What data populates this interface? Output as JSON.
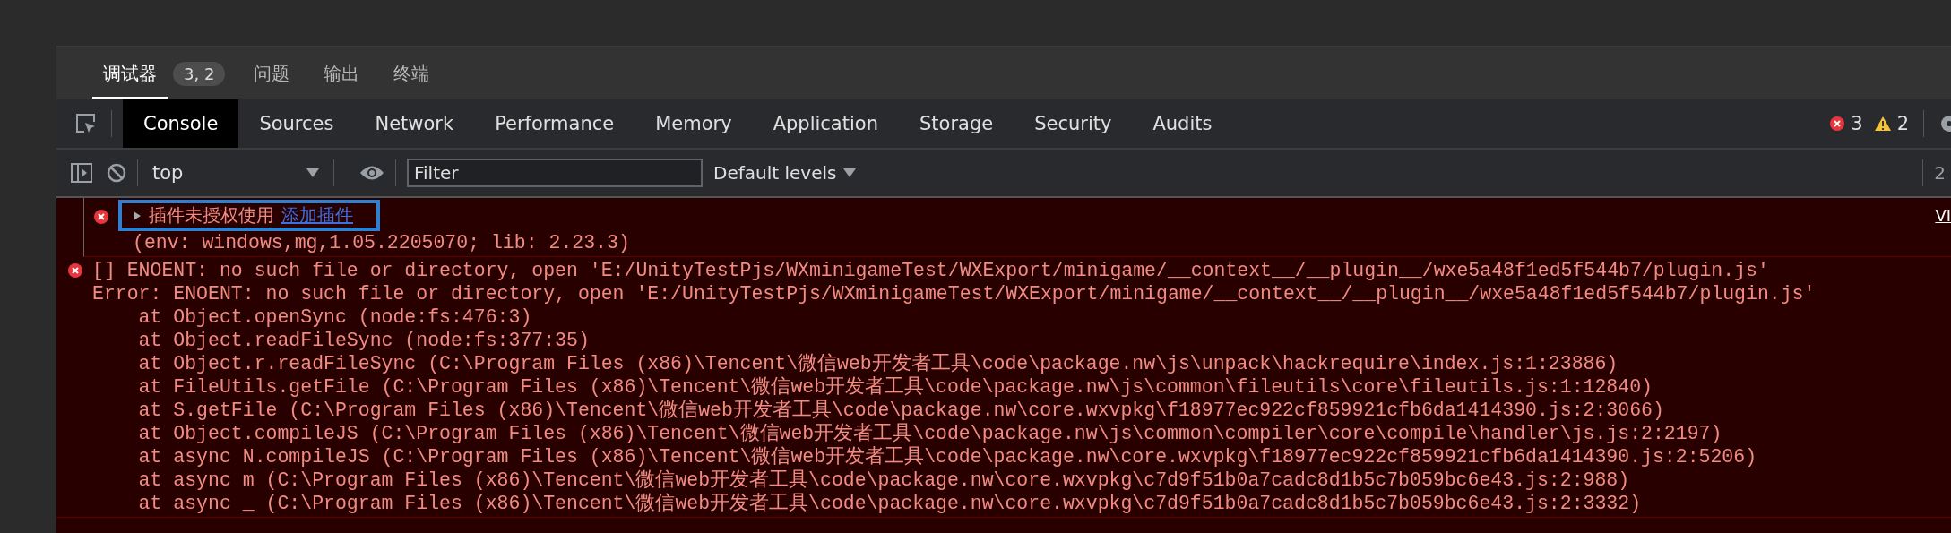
{
  "panel_tabs": [
    {
      "label": "调试器",
      "selected": true,
      "badge": "3, 2"
    },
    {
      "label": "问题",
      "selected": false
    },
    {
      "label": "输出",
      "selected": false
    },
    {
      "label": "终端",
      "selected": false
    }
  ],
  "devtools_tabs": [
    {
      "label": "Console",
      "selected": true
    },
    {
      "label": "Sources",
      "selected": false
    },
    {
      "label": "Network",
      "selected": false
    },
    {
      "label": "Performance",
      "selected": false
    },
    {
      "label": "Memory",
      "selected": false
    },
    {
      "label": "Application",
      "selected": false
    },
    {
      "label": "Storage",
      "selected": false
    },
    {
      "label": "Security",
      "selected": false
    },
    {
      "label": "Audits",
      "selected": false
    }
  ],
  "counts": {
    "errors": "3",
    "warnings": "2"
  },
  "toolbar": {
    "context": "top",
    "filter_placeholder": "Filter",
    "levels": "Default levels",
    "hidden_count": "2"
  },
  "messages": [
    {
      "kind": "error",
      "expanded": false,
      "highlighted": true,
      "text": "插件未授权使用",
      "link": "添加插件",
      "source": "VI",
      "lines": [
        "(env: windows,mg,1.05.2205070; lib: 2.23.3)"
      ]
    },
    {
      "kind": "error",
      "lines": [
        "[] ENOENT: no such file or directory, open 'E:/UnityTestPjs/WXminigameTest/WXExport/minigame/__context__/__plugin__/wxe5a48f1ed5f544b7/plugin.js'",
        "Error: ENOENT: no such file or directory, open 'E:/UnityTestPjs/WXminigameTest/WXExport/minigame/__context__/__plugin__/wxe5a48f1ed5f544b7/plugin.js'",
        "    at Object.openSync (node:fs:476:3)",
        "    at Object.readFileSync (node:fs:377:35)",
        "    at Object.r.readFileSync (C:\\Program Files (x86)\\Tencent\\微信web开发者工具\\code\\package.nw\\js\\unpack\\hackrequire\\index.js:1:23886)",
        "    at FileUtils.getFile (C:\\Program Files (x86)\\Tencent\\微信web开发者工具\\code\\package.nw\\js\\common\\fileutils\\core\\fileutils.js:1:12840)",
        "    at S.getFile (C:\\Program Files (x86)\\Tencent\\微信web开发者工具\\code\\package.nw\\core.wxvpkg\\f18977ec922cf859921cfb6da1414390.js:2:3066)",
        "    at Object.compileJS (C:\\Program Files (x86)\\Tencent\\微信web开发者工具\\code\\package.nw\\js\\common\\compiler\\core\\compile\\handler\\js.js:2:2197)",
        "    at async N.compileJS (C:\\Program Files (x86)\\Tencent\\微信web开发者工具\\code\\package.nw\\core.wxvpkg\\f18977ec922cf859921cfb6da1414390.js:2:5206)",
        "    at async m (C:\\Program Files (x86)\\Tencent\\微信web开发者工具\\code\\package.nw\\core.wxvpkg\\c7d9f51b0a7cadc8d1b5c7b059bc6e43.js:2:988)",
        "    at async _ (C:\\Program Files (x86)\\Tencent\\微信web开发者工具\\code\\package.nw\\core.wxvpkg\\c7d9f51b0a7cadc8d1b5c7b059bc6e43.js:2:3332)"
      ]
    }
  ]
}
